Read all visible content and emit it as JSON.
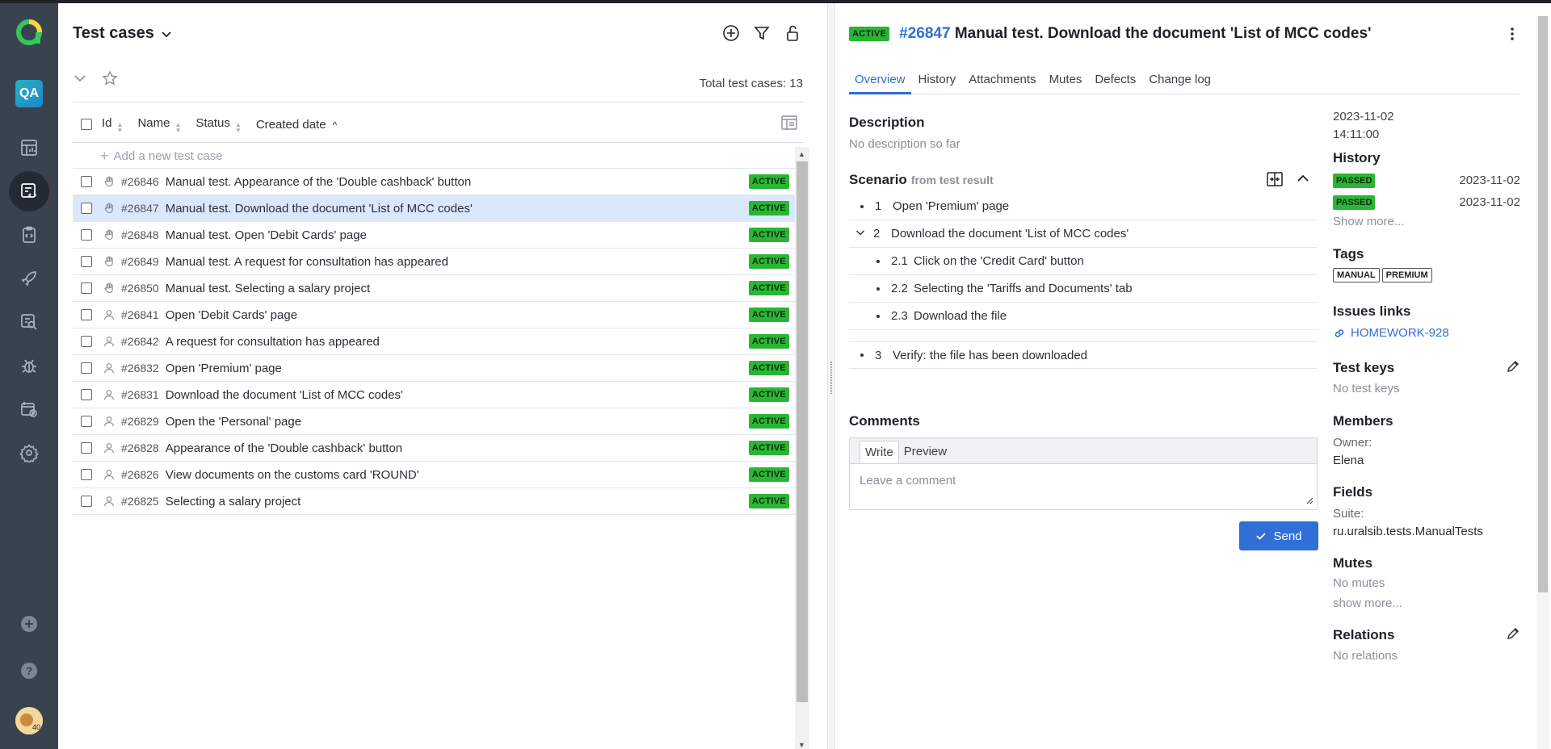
{
  "colors": {
    "rail_bg": "#394350",
    "accent": "#2f6fd6",
    "active_badge": "#2bb534",
    "selected_row": "#dbe8fb"
  },
  "nav": {
    "project_badge": "QA",
    "icons": [
      "dashboards-icon",
      "test-cases-icon",
      "test-plans-icon",
      "launches-icon",
      "analytics-icon",
      "defects-icon",
      "jobs-icon",
      "settings-icon",
      "add-icon",
      "help-icon"
    ],
    "avatar_badge": "40"
  },
  "list": {
    "title": "Test cases",
    "total_label": "Total test cases: 13",
    "columns": {
      "id": "Id",
      "name": "Name",
      "status": "Status",
      "created": "Created date"
    },
    "add_label": "Add a new test case",
    "rows": [
      {
        "id": "#26846",
        "name": "Manual test. Appearance of the 'Double cashback' button",
        "status": "ACTIVE",
        "kind": "manual"
      },
      {
        "id": "#26847",
        "name": "Manual test. Download the document 'List of MCC codes'",
        "status": "ACTIVE",
        "kind": "manual",
        "selected": true
      },
      {
        "id": "#26848",
        "name": "Manual test. Open 'Debit Cards' page",
        "status": "ACTIVE",
        "kind": "manual"
      },
      {
        "id": "#26849",
        "name": "Manual test. A request for consultation has appeared",
        "status": "ACTIVE",
        "kind": "manual"
      },
      {
        "id": "#26850",
        "name": "Manual test. Selecting a salary project",
        "status": "ACTIVE",
        "kind": "manual"
      },
      {
        "id": "#26841",
        "name": "Open 'Debit Cards' page",
        "status": "ACTIVE",
        "kind": "automated"
      },
      {
        "id": "#26842",
        "name": "A request for consultation has appeared",
        "status": "ACTIVE",
        "kind": "automated"
      },
      {
        "id": "#26832",
        "name": "Open 'Premium' page",
        "status": "ACTIVE",
        "kind": "automated"
      },
      {
        "id": "#26831",
        "name": "Download the document 'List of MCC codes'",
        "status": "ACTIVE",
        "kind": "automated"
      },
      {
        "id": "#26829",
        "name": "Open the 'Personal' page",
        "status": "ACTIVE",
        "kind": "automated"
      },
      {
        "id": "#26828",
        "name": "Appearance of the 'Double cashback' button",
        "status": "ACTIVE",
        "kind": "automated"
      },
      {
        "id": "#26826",
        "name": "View documents on the customs card 'ROUND'",
        "status": "ACTIVE",
        "kind": "automated"
      },
      {
        "id": "#26825",
        "name": "Selecting a salary project",
        "status": "ACTIVE",
        "kind": "automated"
      }
    ]
  },
  "detail": {
    "status": "ACTIVE",
    "number": "#26847",
    "title": "Manual test. Download the document 'List of MCC codes'",
    "tabs": [
      "Overview",
      "History",
      "Attachments",
      "Mutes",
      "Defects",
      "Change log"
    ],
    "description_title": "Description",
    "description_empty": "No description so far",
    "scenario_title": "Scenario",
    "scenario_source": "from test result",
    "steps": [
      {
        "num": "1",
        "text": "Open 'Premium' page",
        "level": 0
      },
      {
        "num": "2",
        "text": "Download the document 'List of MCC codes'",
        "level": 0,
        "expandable": true
      },
      {
        "num": "2.1",
        "text": "Click on the 'Credit Card' button",
        "level": 1
      },
      {
        "num": "2.2",
        "text": "Selecting the 'Tariffs and Documents' tab",
        "level": 1
      },
      {
        "num": "2.3",
        "text": "Download the file",
        "level": 1
      },
      {
        "num": "3",
        "text": "Verify: the file has been downloaded",
        "level": 0
      }
    ],
    "comments_title": "Comments",
    "comment_tabs": {
      "write": "Write",
      "preview": "Preview"
    },
    "comment_placeholder": "Leave a comment",
    "send_label": "Send"
  },
  "side": {
    "created_date": "2023-11-02",
    "created_time": "14:11:00",
    "history_title": "History",
    "history": [
      {
        "status": "PASSED",
        "date": "2023-11-02"
      },
      {
        "status": "PASSED",
        "date": "2023-11-02"
      }
    ],
    "show_more": "Show more...",
    "tags_title": "Tags",
    "tags": [
      "MANUAL",
      "PREMIUM"
    ],
    "issues_title": "Issues links",
    "issue": "HOMEWORK-928",
    "test_keys_title": "Test keys",
    "test_keys_empty": "No test keys",
    "members_title": "Members",
    "owner_label": "Owner:",
    "owner": "Elena",
    "fields_title": "Fields",
    "suite_label": "Suite:",
    "suite": "ru.uralsib.tests.ManualTests",
    "mutes_title": "Mutes",
    "mutes_empty": "No mutes",
    "mutes_more": "show more...",
    "relations_title": "Relations",
    "relations_empty": "No relations"
  }
}
